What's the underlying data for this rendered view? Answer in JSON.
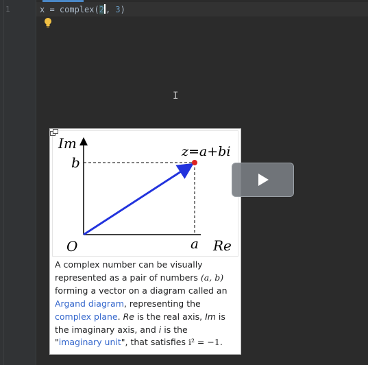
{
  "editor": {
    "line_number": "1",
    "code": {
      "var": "x",
      "op": " = ",
      "fn": "complex",
      "open": "(",
      "arg1": "2",
      "comma": ", ",
      "arg2": "3",
      "close": ")"
    }
  },
  "popup": {
    "diagram": {
      "label_im": "Im",
      "label_re": "Re",
      "label_origin": "O",
      "label_a": "a",
      "label_b": "b",
      "label_z": "z=a+bi"
    },
    "caption": {
      "p1": "A complex number can be visually represented as a pair of numbers ",
      "math_pair": "(a, b)",
      "p2": " forming a vector on a diagram called an ",
      "link_argand": "Argand diagram",
      "p3": ", representing the ",
      "link_complex_plane": "complex plane",
      "p4": ". ",
      "re": "Re",
      "p5": " is the real axis, ",
      "im": "Im",
      "p6": " is the imaginary axis, and ",
      "i": "i",
      "p7": " is the \"",
      "link_imag_unit": "imaginary unit",
      "p8": "\", that satisfies ",
      "math_eq": "i² = −1",
      "p9": "."
    }
  },
  "colors": {
    "vector": "#2233dd",
    "point": "#dd2222",
    "link": "#3366cc"
  },
  "video": {
    "button": "play-icon"
  }
}
